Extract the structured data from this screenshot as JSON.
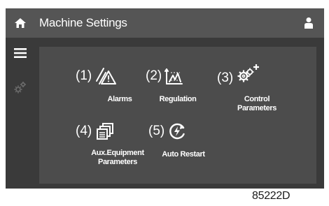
{
  "header": {
    "title": "Machine Settings"
  },
  "icons": {
    "home": "home-icon",
    "user": "user-icon",
    "menu": "menu-icon",
    "settings": "gear-icon"
  },
  "menu_items": [
    {
      "number": "(1)",
      "label": "Alarms",
      "icon": "alarm-warning-icon"
    },
    {
      "number": "(2)",
      "label": "Regulation",
      "icon": "regulation-chart-icon"
    },
    {
      "number": "(3)",
      "label": "Control Parameters",
      "label_lines": [
        "Control",
        "Parameters"
      ],
      "icon": "gear-plus-icon"
    },
    {
      "number": "(4)",
      "label": "Aux.Equipment Parameters",
      "label_lines": [
        "Aux.Equipment",
        "Parameters"
      ],
      "icon": "stacked-pages-icon"
    },
    {
      "number": "(5)",
      "label": "Auto Restart",
      "icon": "auto-restart-icon"
    }
  ],
  "reference_code": "85222D",
  "colors": {
    "screen_bg": "#3a3a3a",
    "topbar_bg": "#555555",
    "panel_bg": "#4c4c4c",
    "foreground": "#ffffff"
  }
}
